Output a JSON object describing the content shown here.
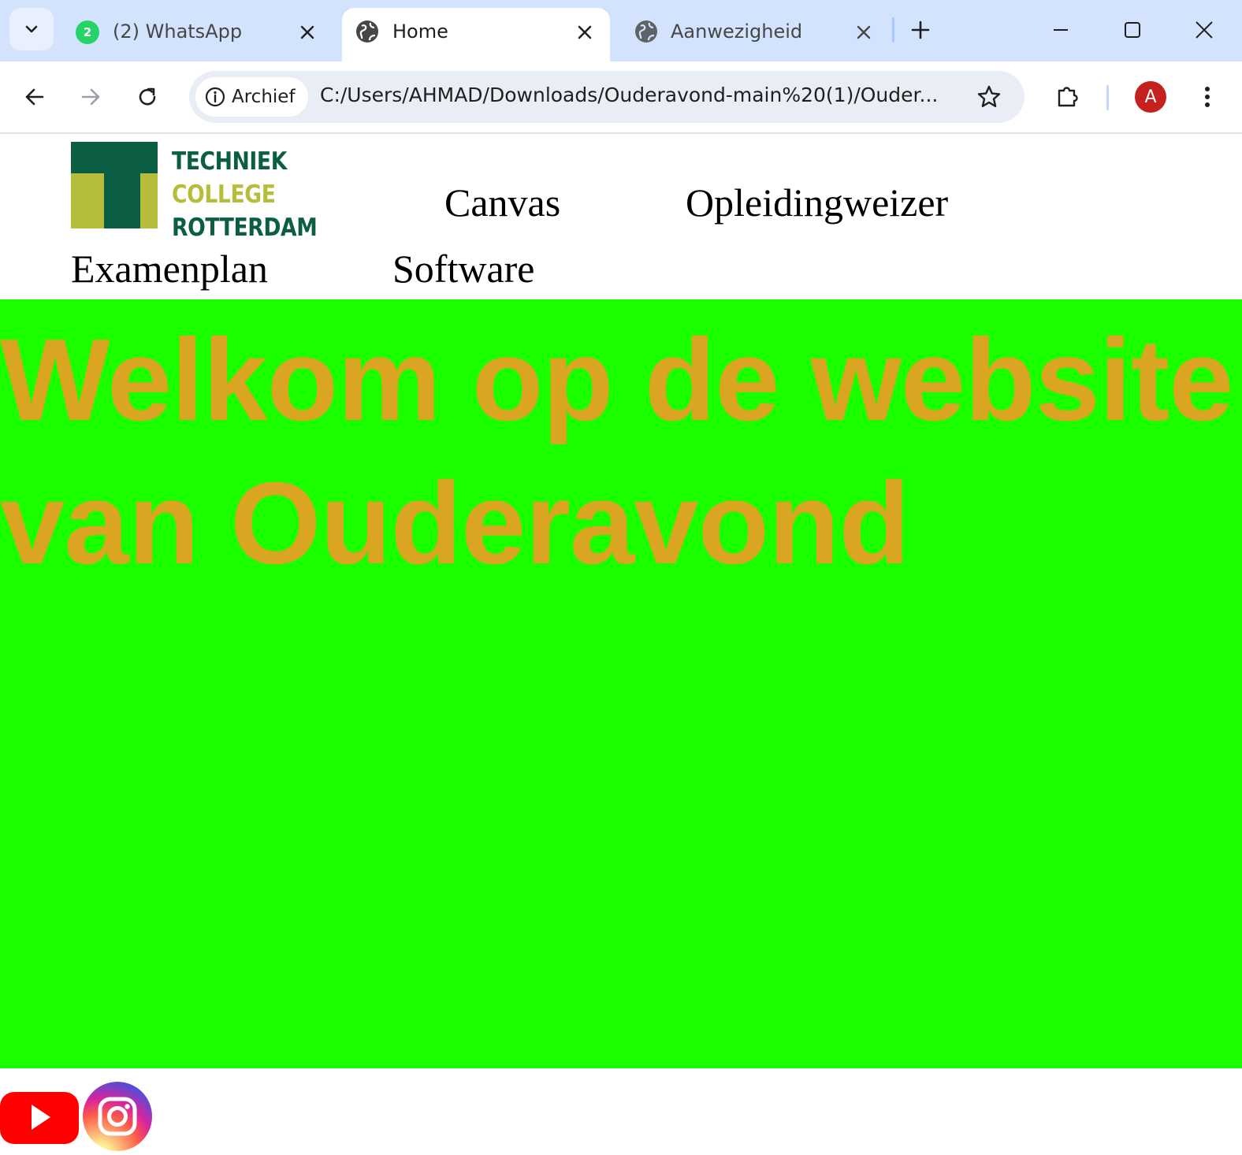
{
  "browser": {
    "tabs": [
      {
        "title": "(2) WhatsApp",
        "badge": "2",
        "active": false
      },
      {
        "title": "Home",
        "active": true
      },
      {
        "title": "Aanwezigheid",
        "active": false
      }
    ],
    "security_chip": "Archief",
    "url": "C:/Users/AHMAD/Downloads/Ouderavond-main%20(1)/Ouder...",
    "profile_initial": "A"
  },
  "site": {
    "logo": {
      "line1": "TECHNIEK",
      "line2": "COLLEGE",
      "line3": "ROTTERDAM"
    },
    "nav": [
      "Canvas",
      "Opleidingweizer",
      "Examenplan",
      "Software"
    ],
    "hero_title": "Welkom op de website van Ouderavond",
    "hero_bg": "#1aff00",
    "hero_color": "#daa520",
    "social": [
      "youtube-icon",
      "instagram-icon"
    ]
  }
}
